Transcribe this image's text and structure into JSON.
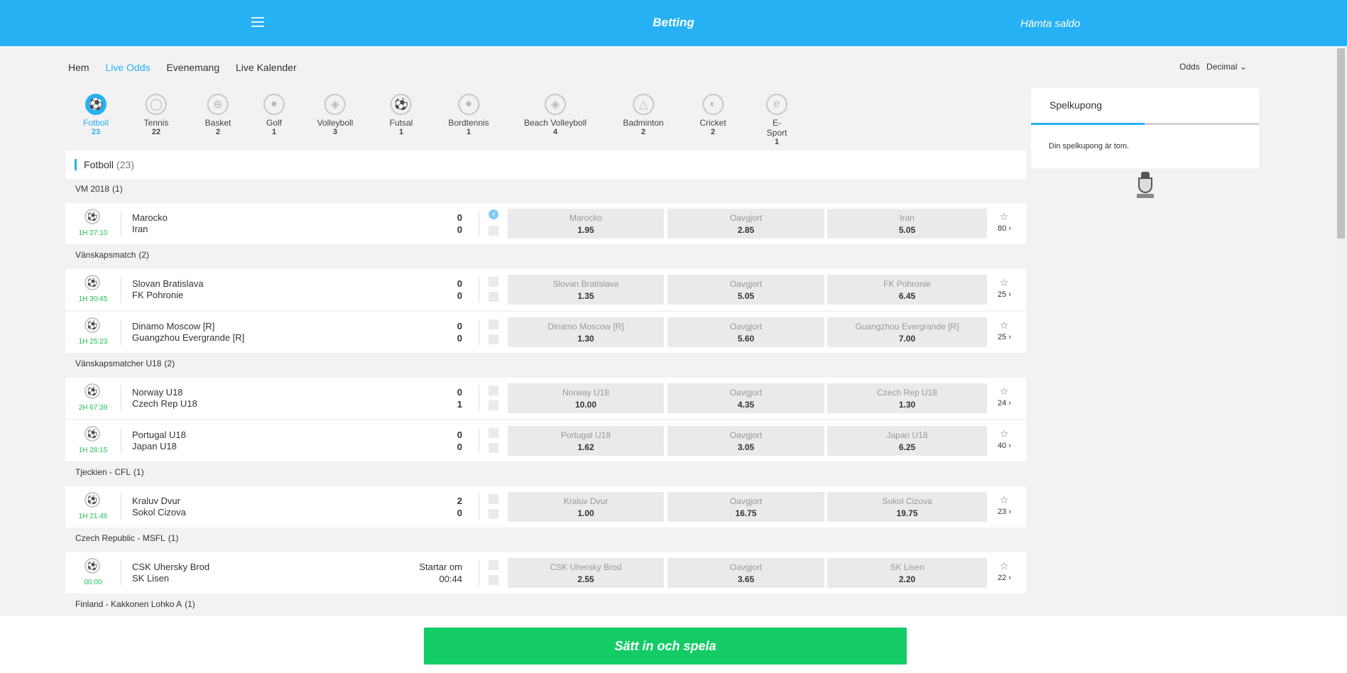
{
  "header": {
    "title": "Betting",
    "balance_label": "Hämta saldo",
    "menu_icon": "hamburger-icon"
  },
  "nav": {
    "items": [
      "Hem",
      "Live Odds",
      "Evenemang",
      "Live Kalender"
    ],
    "active": "Live Odds"
  },
  "odds_format": {
    "label": "Odds",
    "value": "Decimal"
  },
  "sports": [
    {
      "name": "Fotboll",
      "count": "23",
      "icon": "football-icon",
      "active": true
    },
    {
      "name": "Tennis",
      "count": "22",
      "icon": "tennis-icon"
    },
    {
      "name": "Basket",
      "count": "2",
      "icon": "basketball-icon"
    },
    {
      "name": "Golf",
      "count": "1",
      "icon": "golf-icon"
    },
    {
      "name": "Volleyboll",
      "count": "3",
      "icon": "volleyball-icon"
    },
    {
      "name": "Futsal",
      "count": "1",
      "icon": "futsal-icon"
    },
    {
      "name": "Bordtennis",
      "count": "1",
      "icon": "table-tennis-icon"
    },
    {
      "name": "Beach Volleyboll",
      "count": "4",
      "icon": "beach-volleyball-icon"
    },
    {
      "name": "Badminton",
      "count": "2",
      "icon": "badminton-icon"
    },
    {
      "name": "Cricket",
      "count": "2",
      "icon": "cricket-icon"
    },
    {
      "name": "E-Sport",
      "count": "1",
      "icon": "esport-icon"
    }
  ],
  "section": {
    "title": "Fotboll",
    "count": "(23)"
  },
  "groups": [
    {
      "name": "VM 2018",
      "count": "(1)"
    },
    {
      "name": "Vänskapsmatch",
      "count": "(2)"
    },
    {
      "name": "Vänskapsmatcher U18",
      "count": "(2)"
    },
    {
      "name": "Tjeckien - CFL",
      "count": "(1)"
    },
    {
      "name": "Czech Republic - MSFL",
      "count": "(1)"
    },
    {
      "name": "Finland - Kakkonen Lohko A",
      "count": "(1)"
    }
  ],
  "matches": [
    {
      "time": "1H 27:10",
      "team1": "Marocko",
      "team2": "Iran",
      "score1": "0",
      "score2": "0",
      "live_icon": true,
      "odds": [
        {
          "label": "Marocko",
          "value": "1.95"
        },
        {
          "label": "Oavgjort",
          "value": "2.85"
        },
        {
          "label": "Iran",
          "value": "5.05"
        }
      ],
      "markets": "80"
    },
    {
      "time": "1H 30:45",
      "team1": "Slovan Bratislava",
      "team2": "FK Pohronie",
      "score1": "0",
      "score2": "0",
      "odds": [
        {
          "label": "Slovan Bratislava",
          "value": "1.35"
        },
        {
          "label": "Oavgjort",
          "value": "5.05"
        },
        {
          "label": "FK Pohronie",
          "value": "6.45"
        }
      ],
      "markets": "25"
    },
    {
      "time": "1H 25:23",
      "team1": "Dinamo Moscow [R]",
      "team2": "Guangzhou Evergrande [R]",
      "score1": "0",
      "score2": "0",
      "odds": [
        {
          "label": "Dinamo Moscow [R]",
          "value": "1.30"
        },
        {
          "label": "Oavgjort",
          "value": "5.60"
        },
        {
          "label": "Guangzhou Evergrande [R]",
          "value": "7.00"
        }
      ],
      "markets": "25"
    },
    {
      "time": "2H 67:39",
      "team1": "Norway U18",
      "team2": "Czech Rep U18",
      "score1": "0",
      "score2": "1",
      "odds": [
        {
          "label": "Norway U18",
          "value": "10.00"
        },
        {
          "label": "Oavgjort",
          "value": "4.35"
        },
        {
          "label": "Czech Rep U18",
          "value": "1.30"
        }
      ],
      "markets": "24"
    },
    {
      "time": "1H 28:15",
      "team1": "Portugal U18",
      "team2": "Japan U18",
      "score1": "0",
      "score2": "0",
      "odds": [
        {
          "label": "Portugal U18",
          "value": "1.62"
        },
        {
          "label": "Oavgjort",
          "value": "3.05"
        },
        {
          "label": "Japan U18",
          "value": "6.25"
        }
      ],
      "markets": "40"
    },
    {
      "time": "1H 21:46",
      "team1": "Kraluv Dvur",
      "team2": "Sokol Cizova",
      "score1": "2",
      "score2": "0",
      "odds": [
        {
          "label": "Kraluv Dvur",
          "value": "1.00"
        },
        {
          "label": "Oavgjort",
          "value": "16.75"
        },
        {
          "label": "Sokol Cizova",
          "value": "19.75"
        }
      ],
      "markets": "23"
    },
    {
      "time": "00:00",
      "team1": "CSK Uhersky Brod",
      "team2": "SK Lisen",
      "starts_label": "Startar om",
      "starts_in": "00:44",
      "odds": [
        {
          "label": "CSK Uhersky Brod",
          "value": "2.55"
        },
        {
          "label": "Oavgjort",
          "value": "3.65"
        },
        {
          "label": "SK Lisen",
          "value": "2.20"
        }
      ],
      "markets": "22"
    }
  ],
  "coupon": {
    "tab": "Spelkupong",
    "empty_text": "Din spelkupong är tom."
  },
  "cta": {
    "label": "Sätt in och spela"
  },
  "colors": {
    "brand": "#27b1f5",
    "cta": "#14cc66",
    "live_time": "#1dbf52"
  }
}
